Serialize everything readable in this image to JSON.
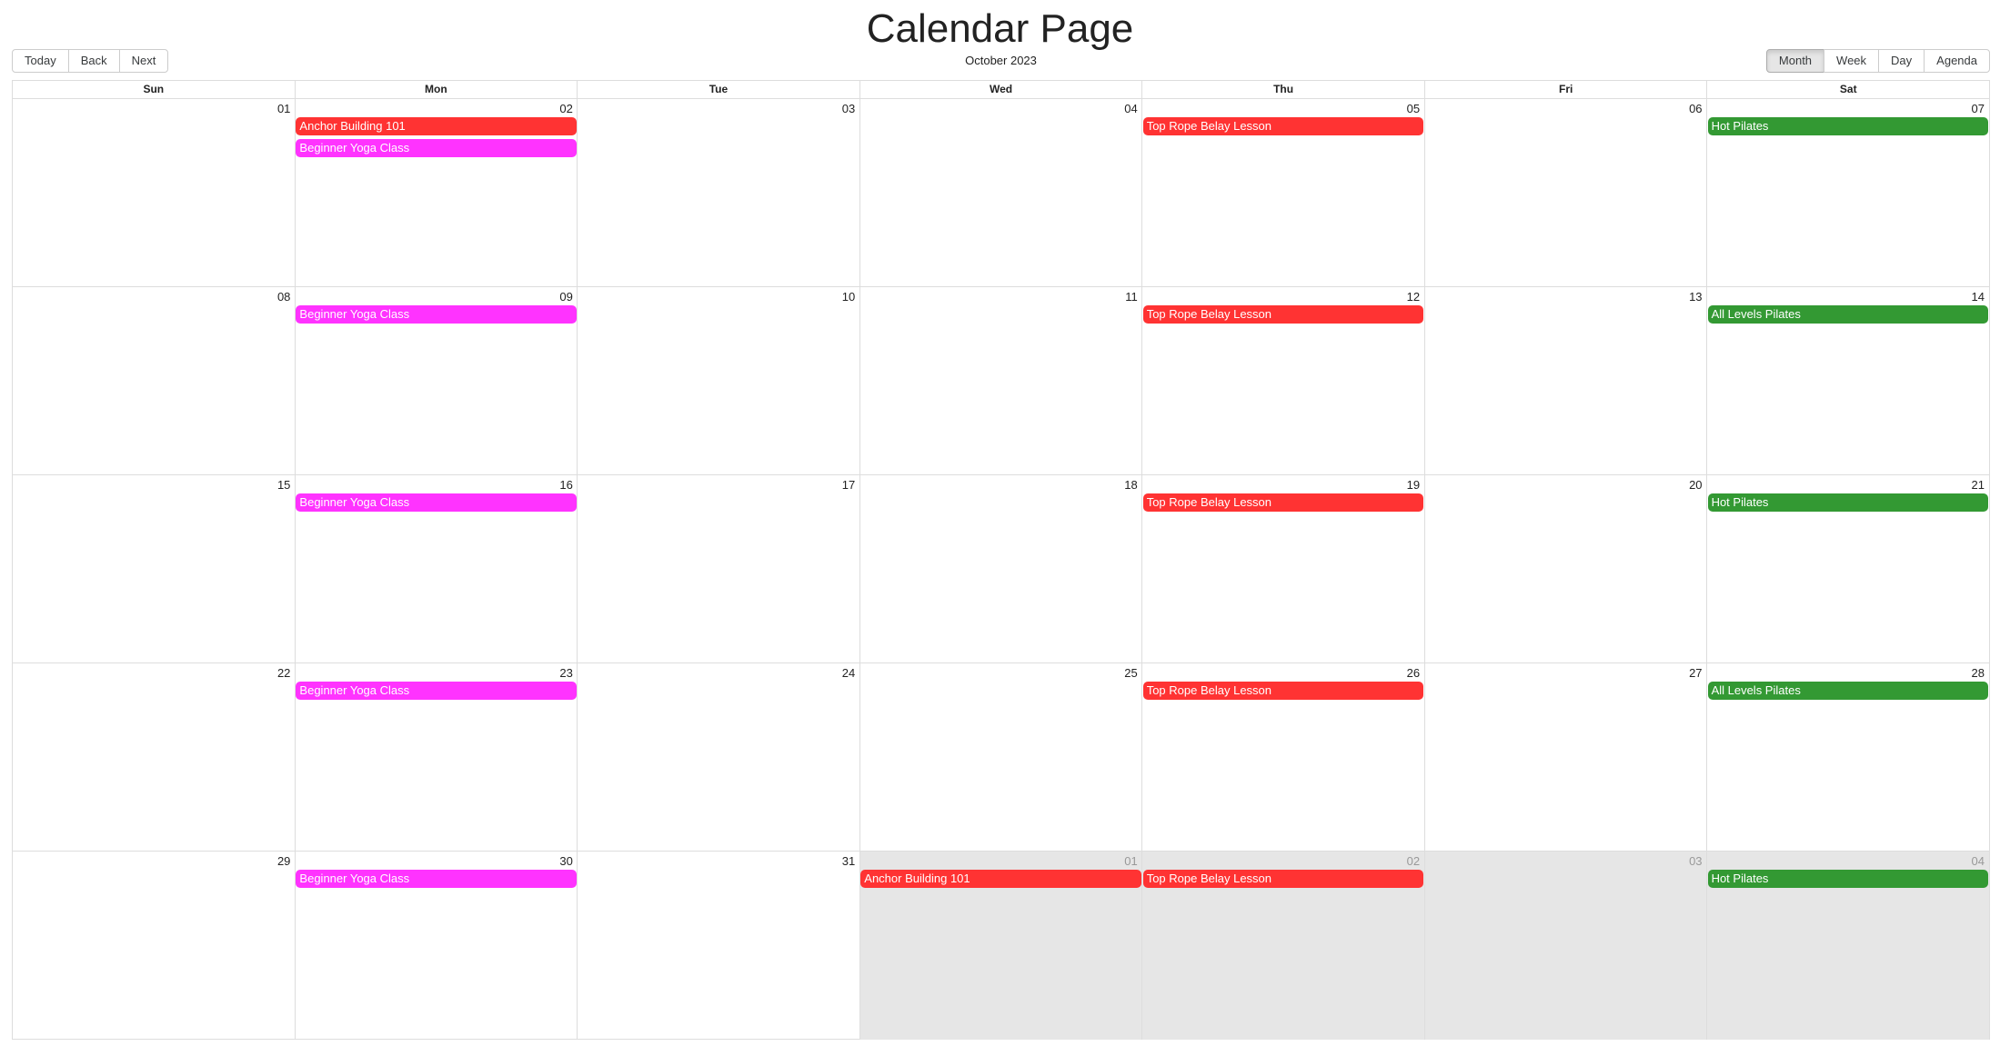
{
  "page": {
    "title": "Calendar Page"
  },
  "toolbar": {
    "nav": [
      "Today",
      "Back",
      "Next"
    ],
    "label": "October 2023",
    "views": [
      "Month",
      "Week",
      "Day",
      "Agenda"
    ],
    "active_view": "Month"
  },
  "weekdays": [
    "Sun",
    "Mon",
    "Tue",
    "Wed",
    "Thu",
    "Fri",
    "Sat"
  ],
  "weeks": [
    {
      "dates": [
        "01",
        "02",
        "03",
        "04",
        "05",
        "06",
        "07"
      ],
      "off_range": [
        false,
        false,
        false,
        false,
        false,
        false,
        false
      ],
      "events": [
        {
          "day": 1,
          "slot": 0,
          "title": "Anchor Building 101",
          "color": "red"
        },
        {
          "day": 1,
          "slot": 1,
          "title": "Beginner Yoga Class",
          "color": "magenta"
        },
        {
          "day": 4,
          "slot": 0,
          "title": "Top Rope Belay Lesson",
          "color": "red"
        },
        {
          "day": 6,
          "slot": 0,
          "title": "Hot Pilates",
          "color": "green"
        }
      ]
    },
    {
      "dates": [
        "08",
        "09",
        "10",
        "11",
        "12",
        "13",
        "14"
      ],
      "off_range": [
        false,
        false,
        false,
        false,
        false,
        false,
        false
      ],
      "events": [
        {
          "day": 1,
          "slot": 0,
          "title": "Beginner Yoga Class",
          "color": "magenta"
        },
        {
          "day": 4,
          "slot": 0,
          "title": "Top Rope Belay Lesson",
          "color": "red"
        },
        {
          "day": 6,
          "slot": 0,
          "title": "All Levels Pilates",
          "color": "green"
        }
      ]
    },
    {
      "dates": [
        "15",
        "16",
        "17",
        "18",
        "19",
        "20",
        "21"
      ],
      "off_range": [
        false,
        false,
        false,
        false,
        false,
        false,
        false
      ],
      "events": [
        {
          "day": 1,
          "slot": 0,
          "title": "Beginner Yoga Class",
          "color": "magenta"
        },
        {
          "day": 4,
          "slot": 0,
          "title": "Top Rope Belay Lesson",
          "color": "red"
        },
        {
          "day": 6,
          "slot": 0,
          "title": "Hot Pilates",
          "color": "green"
        }
      ]
    },
    {
      "dates": [
        "22",
        "23",
        "24",
        "25",
        "26",
        "27",
        "28"
      ],
      "off_range": [
        false,
        false,
        false,
        false,
        false,
        false,
        false
      ],
      "events": [
        {
          "day": 1,
          "slot": 0,
          "title": "Beginner Yoga Class",
          "color": "magenta"
        },
        {
          "day": 4,
          "slot": 0,
          "title": "Top Rope Belay Lesson",
          "color": "red"
        },
        {
          "day": 6,
          "slot": 0,
          "title": "All Levels Pilates",
          "color": "green"
        }
      ]
    },
    {
      "dates": [
        "29",
        "30",
        "31",
        "01",
        "02",
        "03",
        "04"
      ],
      "off_range": [
        false,
        false,
        false,
        true,
        true,
        true,
        true
      ],
      "events": [
        {
          "day": 1,
          "slot": 0,
          "title": "Beginner Yoga Class",
          "color": "magenta"
        },
        {
          "day": 3,
          "slot": 0,
          "title": "Anchor Building 101",
          "color": "red"
        },
        {
          "day": 4,
          "slot": 0,
          "title": "Top Rope Belay Lesson",
          "color": "red"
        },
        {
          "day": 6,
          "slot": 0,
          "title": "Hot Pilates",
          "color": "green"
        }
      ]
    }
  ]
}
